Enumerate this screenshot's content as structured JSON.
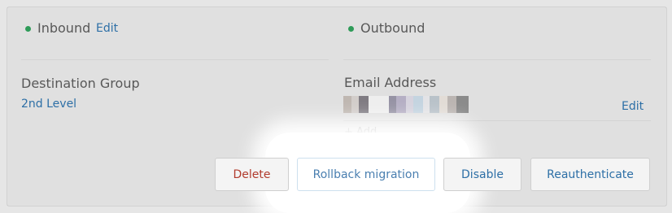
{
  "inbound": {
    "title": "Inbound",
    "status_color": "#2e9b58",
    "edit_label": "Edit"
  },
  "outbound": {
    "title": "Outbound",
    "status_color": "#2e9b58"
  },
  "destination_group": {
    "label": "Destination Group",
    "value": "2nd Level"
  },
  "email_address": {
    "label": "Email Address",
    "edit_label": "Edit",
    "add_label": "+ Add"
  },
  "actions": {
    "delete_label": "Delete",
    "rollback_label": "Rollback migration",
    "disable_label": "Disable",
    "reauthenticate_label": "Reauthenticate"
  },
  "colors": {
    "link": "#2d6fa6",
    "danger": "#b13c2e",
    "status_active": "#2e9b58"
  }
}
